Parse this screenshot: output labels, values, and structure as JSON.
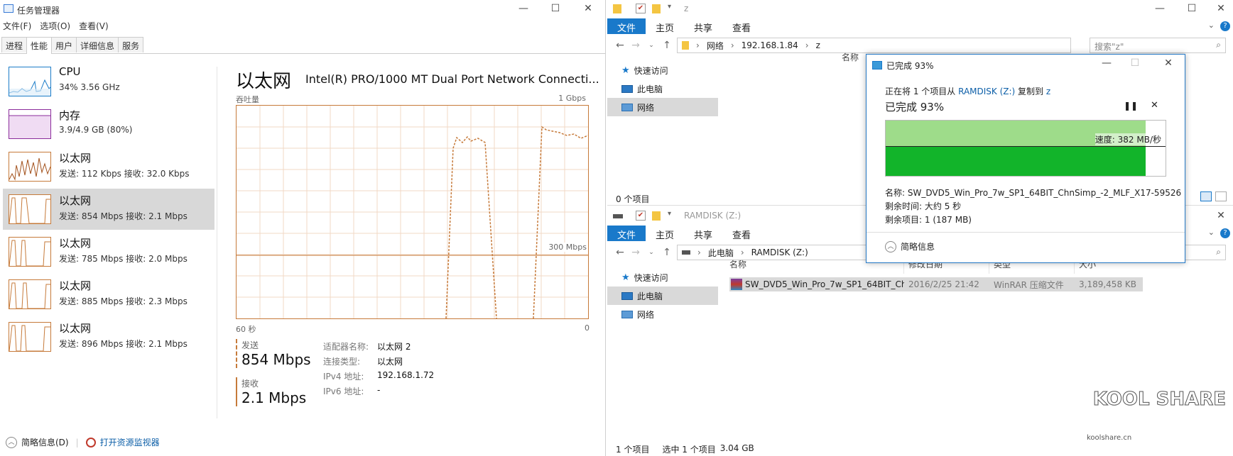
{
  "task_manager": {
    "title": "任务管理器",
    "window_controls": [
      "—",
      "☐",
      "✕"
    ],
    "menu": [
      "文件(F)",
      "选项(O)",
      "查看(V)"
    ],
    "tabs": [
      "进程",
      "性能",
      "用户",
      "详细信息",
      "服务"
    ],
    "active_tab": "性能",
    "sidebar": [
      {
        "name": "CPU",
        "sub": "34%  3.56 GHz",
        "kind": "cpu"
      },
      {
        "name": "内存",
        "sub": "3.9/4.9 GB (80%)",
        "kind": "mem"
      },
      {
        "name": "以太网",
        "sub": "发送: 112 Kbps  接收: 32.0 Kbps",
        "kind": "eth"
      },
      {
        "name": "以太网",
        "sub": "发送: 854 Mbps  接收: 2.1 Mbps",
        "kind": "eth"
      },
      {
        "name": "以太网",
        "sub": "发送: 785 Mbps  接收: 2.0 Mbps",
        "kind": "eth"
      },
      {
        "name": "以太网",
        "sub": "发送: 885 Mbps  接收: 2.3 Mbps",
        "kind": "eth"
      },
      {
        "name": "以太网",
        "sub": "发送: 896 Mbps  接收: 2.1 Mbps",
        "kind": "eth"
      }
    ],
    "selected_index": 3,
    "detail": {
      "title": "以太网",
      "adapter": "Intel(R) PRO/1000 MT Dual Port Network Connecti...",
      "throughput_label": "吞吐量",
      "max_label": "1 Gbps",
      "mid_label": "300 Mbps",
      "x_left": "60 秒",
      "x_right": "0",
      "send_label": "发送",
      "send_value": "854 Mbps",
      "recv_label": "接收",
      "recv_value": "2.1 Mbps",
      "info": [
        {
          "label": "适配器名称:",
          "value": "以太网 2"
        },
        {
          "label": "连接类型:",
          "value": "以太网"
        },
        {
          "label": "IPv4 地址:",
          "value": "192.168.1.72"
        },
        {
          "label": "IPv6 地址:",
          "value": "-"
        }
      ]
    },
    "footer": {
      "summary": "简略信息(D)",
      "resource_monitor": "打开资源监视器"
    }
  },
  "explorer_top": {
    "title": "z",
    "ribbon": [
      "文件",
      "主页",
      "共享",
      "查看"
    ],
    "path": [
      "网络",
      "192.168.1.84",
      "z"
    ],
    "search_placeholder": "搜索\"z\"",
    "nav": [
      "快速访问",
      "此电脑",
      "网络"
    ],
    "selected_nav": "网络",
    "col_name": "名称",
    "status": "0 个项目"
  },
  "explorer_bottom": {
    "title": "RAMDISK (Z:)",
    "ribbon": [
      "文件",
      "主页",
      "共享",
      "查看"
    ],
    "path": [
      "此电脑",
      "RAMDISK (Z:)"
    ],
    "nav": [
      "快速访问",
      "此电脑",
      "网络"
    ],
    "selected_nav": "此电脑",
    "columns": [
      "名称",
      "修改日期",
      "类型",
      "大小"
    ],
    "file": {
      "name": "SW_DVD5_Win_Pro_7w_SP1_64BIT_Ch...",
      "date": "2016/2/25 21:42",
      "type": "WinRAR 压缩文件",
      "size": "3,189,458 KB"
    },
    "status_items": "1 个项目",
    "status_selected": "选中 1 个项目",
    "status_size": "3.04 GB"
  },
  "copy_dialog": {
    "title": "已完成 93%",
    "line1_prefix": "正在将 1 个项目从",
    "source": "RAMDISK (Z:)",
    "line1_mid": "复制到",
    "dest": "z",
    "heading": "已完成 93%",
    "progress": 0.93,
    "speed": "速度: 382 MB/秒",
    "name_label": "名称:",
    "name_value": "SW_DVD5_Win_Pro_7w_SP1_64BIT_ChnSimp_-2_MLF_X17-59526",
    "time_label": "剩余时间:",
    "time_value": "大约 5 秒",
    "items_label": "剩余项目:",
    "items_value": "1 (187 MB)",
    "summary": "简略信息"
  },
  "watermark": {
    "brand": "KOOL SHARE",
    "site": "koolshare.cn"
  },
  "colors": {
    "network_orange": "#c67a3a",
    "cpu_blue": "#1b7cc8",
    "mem_purple": "#8b2c9b",
    "ribbon_blue": "#1979ca",
    "progress_green": "#12b42a",
    "progress_light": "#9edc8a"
  }
}
